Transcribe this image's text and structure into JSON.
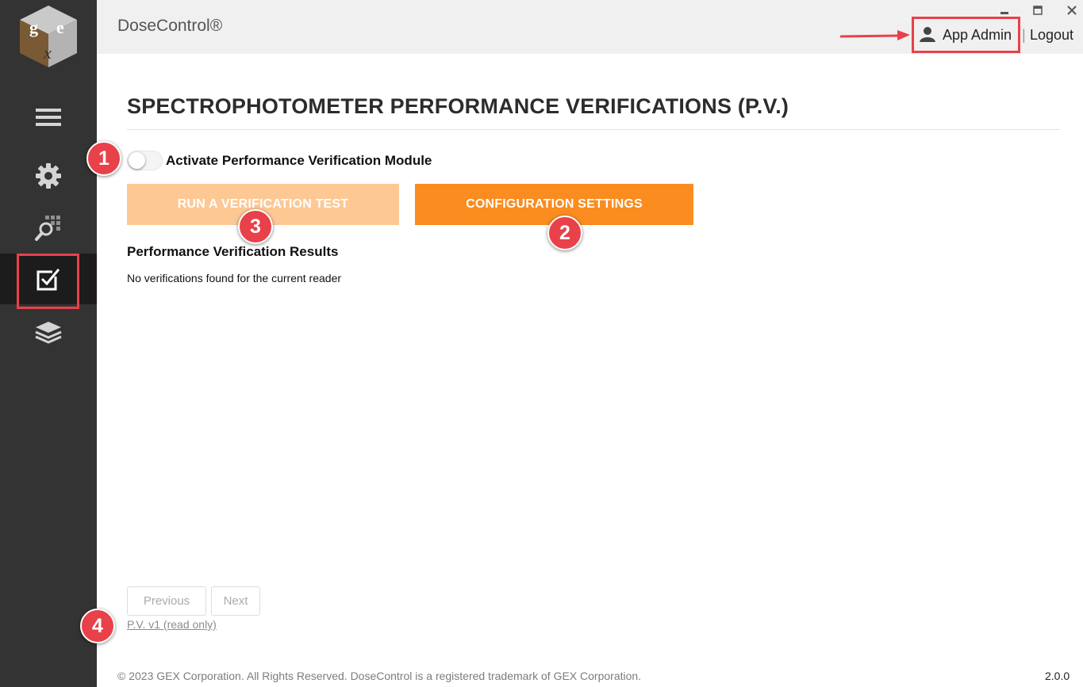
{
  "app": {
    "title": "DoseControl®",
    "user_name": "App Admin",
    "separator": "|",
    "logout_label": "Logout",
    "version": "2.0.0"
  },
  "window_controls": [
    "minimize-icon",
    "maximize-icon",
    "close-icon"
  ],
  "sidebar": {
    "logo_letters": [
      "g",
      "e",
      "x"
    ],
    "items": [
      {
        "icon": "hamburger-icon",
        "active": false
      },
      {
        "icon": "gear-icon",
        "active": false
      },
      {
        "icon": "grid-search-icon",
        "active": false
      },
      {
        "icon": "checkbox-icon",
        "active": true
      },
      {
        "icon": "layers-icon",
        "active": false
      }
    ]
  },
  "main": {
    "page_title": "SPECTROPHOTOMETER PERFORMANCE VERIFICATIONS (P.V.)",
    "toggle_label": "Activate Performance Verification Module",
    "toggle_on": false,
    "run_button_label": "RUN A VERIFICATION TEST",
    "config_button_label": "CONFIGURATION SETTINGS",
    "results_heading": "Performance Verification Results",
    "results_empty": "No verifications found for the current reader",
    "pagination": {
      "previous_label": "Previous",
      "next_label": "Next"
    },
    "version_link": "P.V. v1 (read only)"
  },
  "footer": {
    "copyright": "© 2023 GEX Corporation. All Rights Reserved. DoseControl is a registered trademark of GEX Corporation."
  },
  "annotations": {
    "callouts": [
      "1",
      "2",
      "3",
      "4"
    ]
  },
  "colors": {
    "sidebar_bg": "#333333",
    "accent_orange": "#fb8c1f",
    "disabled_orange": "#fdc894",
    "callout_red": "#e8414a"
  }
}
